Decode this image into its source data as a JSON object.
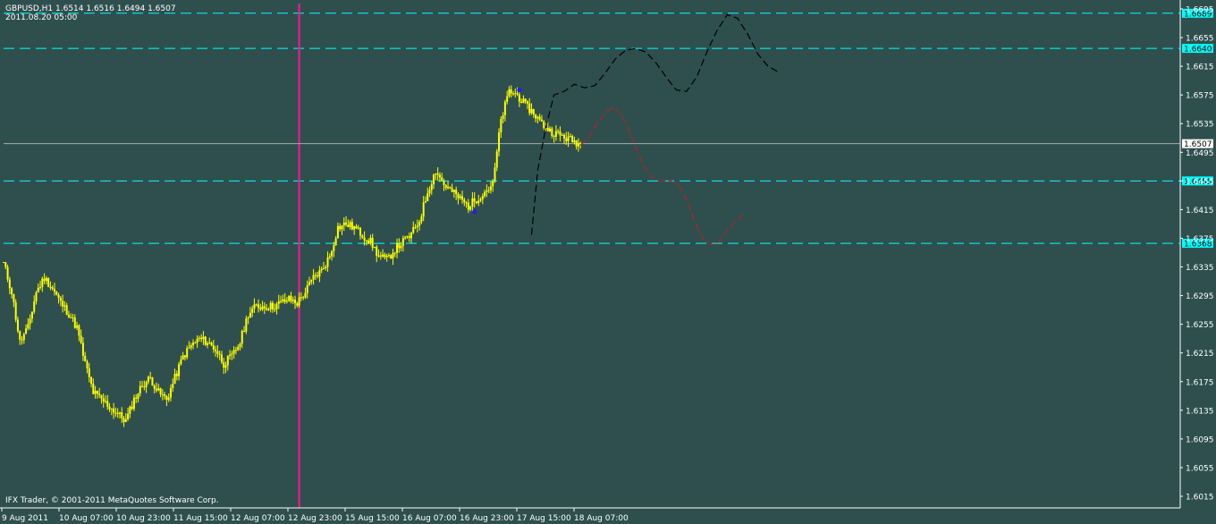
{
  "header": {
    "symbol_line": "GBPUSD,H1  1.6514 1.6516 1.6494 1.6507",
    "datetime": "2011.08.20 05:00"
  },
  "footer": {
    "copyright": "IFX Trader, © 2001-2011 MetaQuotes Software Corp."
  },
  "colors": {
    "background": "#2F4F4F",
    "candles": "#FFFF00",
    "level_lines": "#00FFFF",
    "vertical_marker": "#FF1493",
    "upper_projection": "#000000",
    "lower_projection": "#B22222",
    "current_price_line": "#A9A9A9",
    "swing_markers": "#1E1EFF",
    "axis_text": "#FFFFFF"
  },
  "chart_data": {
    "type": "candlestick",
    "symbol": "GBPUSD",
    "timeframe": "H1",
    "ylim": [
      1.6005,
      1.6695
    ],
    "y_ticks": [
      "1.6695",
      "1.6655",
      "1.6615",
      "1.6575",
      "1.6535",
      "1.6495",
      "1.6455",
      "1.6415",
      "1.6375",
      "1.6335",
      "1.6295",
      "1.6255",
      "1.6215",
      "1.6175",
      "1.6135",
      "1.6095",
      "1.6055",
      "1.6015"
    ],
    "x_ticks": [
      "9 Aug 2011",
      "10 Aug 07:00",
      "10 Aug 23:00",
      "11 Aug 15:00",
      "12 Aug 07:00",
      "12 Aug 23:00",
      "15 Aug 15:00",
      "16 Aug 07:00",
      "16 Aug 23:00",
      "17 Aug 15:00",
      "18 Aug 07:00"
    ],
    "current_price": 1.6507,
    "current_price_label": "1.6507",
    "horizontal_levels": [
      {
        "value": 1.6689,
        "label": "1.6689"
      },
      {
        "value": 1.664,
        "label": "1.6640"
      },
      {
        "value": 1.6455,
        "label": "1.6455"
      },
      {
        "value": 1.6368,
        "label": "1.6368"
      }
    ],
    "vertical_marker_bar": 145,
    "close_path": [
      [
        0,
        1.634
      ],
      [
        4,
        1.63
      ],
      [
        8,
        1.623
      ],
      [
        12,
        1.625
      ],
      [
        16,
        1.63
      ],
      [
        20,
        1.632
      ],
      [
        24,
        1.6305
      ],
      [
        28,
        1.6285
      ],
      [
        32,
        1.627
      ],
      [
        36,
        1.625
      ],
      [
        40,
        1.62
      ],
      [
        44,
        1.616
      ],
      [
        48,
        1.615
      ],
      [
        52,
        1.614
      ],
      [
        56,
        1.613
      ],
      [
        60,
        1.612
      ],
      [
        64,
        1.615
      ],
      [
        68,
        1.617
      ],
      [
        72,
        1.618
      ],
      [
        76,
        1.616
      ],
      [
        80,
        1.615
      ],
      [
        84,
        1.618
      ],
      [
        88,
        1.621
      ],
      [
        92,
        1.6225
      ],
      [
        96,
        1.6235
      ],
      [
        100,
        1.623
      ],
      [
        104,
        1.622
      ],
      [
        108,
        1.62
      ],
      [
        112,
        1.621
      ],
      [
        116,
        1.623
      ],
      [
        120,
        1.627
      ],
      [
        124,
        1.628
      ],
      [
        128,
        1.628
      ],
      [
        132,
        1.628
      ],
      [
        136,
        1.6285
      ],
      [
        140,
        1.629
      ],
      [
        144,
        1.6285
      ],
      [
        148,
        1.63
      ],
      [
        152,
        1.632
      ],
      [
        156,
        1.633
      ],
      [
        160,
        1.635
      ],
      [
        164,
        1.639
      ],
      [
        168,
        1.6395
      ],
      [
        172,
        1.639
      ],
      [
        176,
        1.638
      ],
      [
        180,
        1.637
      ],
      [
        184,
        1.635
      ],
      [
        188,
        1.6345
      ],
      [
        192,
        1.636
      ],
      [
        196,
        1.637
      ],
      [
        200,
        1.638
      ],
      [
        204,
        1.64
      ],
      [
        208,
        1.644
      ],
      [
        212,
        1.647
      ],
      [
        216,
        1.645
      ],
      [
        220,
        1.644
      ],
      [
        224,
        1.643
      ],
      [
        228,
        1.642
      ],
      [
        232,
        1.643
      ],
      [
        236,
        1.644
      ],
      [
        240,
        1.645
      ],
      [
        244,
        1.654
      ],
      [
        248,
        1.658
      ],
      [
        252,
        1.6575
      ],
      [
        256,
        1.656
      ],
      [
        260,
        1.655
      ],
      [
        264,
        1.6535
      ],
      [
        268,
        1.6525
      ],
      [
        272,
        1.652
      ],
      [
        276,
        1.6515
      ],
      [
        280,
        1.651
      ],
      [
        283,
        1.6507
      ]
    ],
    "upper_projection": [
      [
        259,
        1.638
      ],
      [
        262,
        1.647
      ],
      [
        266,
        1.653
      ],
      [
        270,
        1.6575
      ],
      [
        275,
        1.658
      ],
      [
        280,
        1.659
      ],
      [
        285,
        1.6585
      ],
      [
        290,
        1.6588
      ],
      [
        295,
        1.6605
      ],
      [
        300,
        1.6625
      ],
      [
        305,
        1.6637
      ],
      [
        310,
        1.664
      ],
      [
        315,
        1.6635
      ],
      [
        320,
        1.662
      ],
      [
        325,
        1.66
      ],
      [
        330,
        1.6582
      ],
      [
        335,
        1.658
      ],
      [
        340,
        1.66
      ],
      [
        345,
        1.6635
      ],
      [
        350,
        1.6665
      ],
      [
        355,
        1.6687
      ],
      [
        360,
        1.6682
      ],
      [
        365,
        1.666
      ],
      [
        370,
        1.6632
      ],
      [
        375,
        1.6615
      ],
      [
        380,
        1.6607
      ]
    ],
    "lower_projection": [
      [
        283,
        1.6505
      ],
      [
        287,
        1.6515
      ],
      [
        291,
        1.6535
      ],
      [
        295,
        1.655
      ],
      [
        299,
        1.6558
      ],
      [
        303,
        1.6548
      ],
      [
        307,
        1.6525
      ],
      [
        311,
        1.6495
      ],
      [
        315,
        1.647
      ],
      [
        319,
        1.6457
      ],
      [
        323,
        1.6455
      ],
      [
        327,
        1.6455
      ],
      [
        331,
        1.645
      ],
      [
        335,
        1.643
      ],
      [
        339,
        1.6398
      ],
      [
        343,
        1.6375
      ],
      [
        347,
        1.6366
      ],
      [
        351,
        1.637
      ],
      [
        355,
        1.6385
      ],
      [
        359,
        1.64
      ],
      [
        363,
        1.6408
      ]
    ],
    "swing_markers": [
      {
        "bar": 231,
        "price": 1.6412
      },
      {
        "bar": 253,
        "price": 1.6582
      }
    ]
  }
}
